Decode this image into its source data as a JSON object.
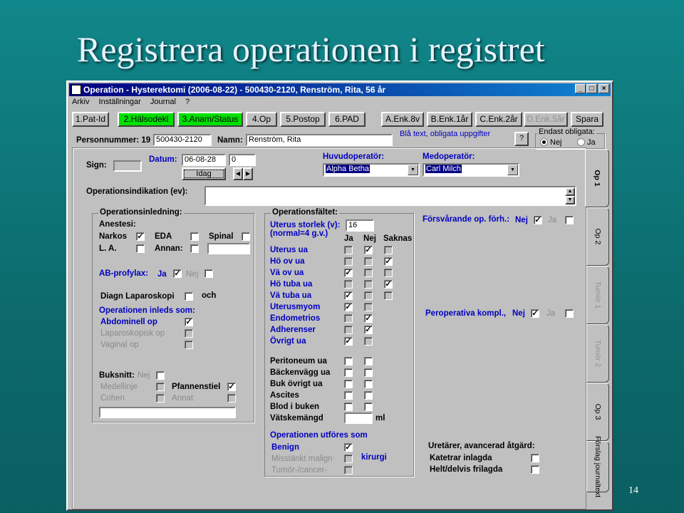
{
  "slide": {
    "title": "Registrera operationen i registret",
    "page_number": "14"
  },
  "window": {
    "title": "Operation - Hysterektomi (2006-08-22) - 500430-2120, Renström, Rita, 56 år",
    "menu": [
      "Arkiv",
      "Inställningar",
      "Journal",
      "?"
    ],
    "tabs": [
      {
        "label": "1.Pat-Id",
        "state": "normal"
      },
      {
        "label": "2.Hälsodekl",
        "state": "green"
      },
      {
        "label": "3.Anam/Status",
        "state": "green"
      },
      {
        "label": "4.Op",
        "state": "normal"
      },
      {
        "label": "5.Postop",
        "state": "normal"
      },
      {
        "label": "6.PAD",
        "state": "normal"
      },
      {
        "label": "A.Enk.8v",
        "state": "normal"
      },
      {
        "label": "B.Enk.1år",
        "state": "normal"
      },
      {
        "label": "C.Enk.2år",
        "state": "normal"
      },
      {
        "label": "D.Enk.5år",
        "state": "disabled"
      },
      {
        "label": "Spara",
        "state": "normal"
      }
    ],
    "patient": {
      "personnummer_label": "Personnummer: 19",
      "personnummer_value": "500430-2120",
      "namn_label": "Namn:",
      "namn_value": "Renström, Rita",
      "hint": "Blå text, obligata uppgifter",
      "help": "?",
      "endast_label": "Endast obligata:",
      "nej": "Nej",
      "ja": "Ja"
    },
    "header_fields": {
      "sign_label": "Sign:",
      "datum_label": "Datum:",
      "datum_value": "06-08-28",
      "datum_extra": "0",
      "idag": "Idag",
      "huvudoperator_label": "Huvudoperatör:",
      "huvudoperator_value": "Alpha Betha",
      "medoperator_label": "Medoperatör:",
      "medoperator_value": "Carl Milch",
      "indikation_label": "Operationsindikation (ev):"
    },
    "inledning": {
      "title": "Operationsinledning:",
      "anestesi": "Anestesi:",
      "narkos": "Narkos",
      "eda": "EDA",
      "spinal": "Spinal",
      "la": "L. A.",
      "annan": "Annan:",
      "ab_label": "AB-profylax:",
      "ja": "Ja",
      "nej": "Nej",
      "diagn": "Diagn Laparoskopi",
      "och": "och",
      "inleds": "Operationen inleds som:",
      "abdominell": "Abdominell op",
      "laparoskopisk": "Laparoskopisk op",
      "vaginal": "Vaginal op",
      "buksnitt": "Buksnitt:",
      "buk_nej": "Nej",
      "medellinje": "Medellinje",
      "pfannenstiel": "Pfannenstiel",
      "cohen": "Cohen",
      "annat": "Annat"
    },
    "faltet": {
      "title": "Operationsfältet:",
      "uterus_storlek": "Uterus storlek (v):",
      "uterus_storlek_value": "16",
      "normal": "(normal=4 g.v.)",
      "col_ja": "Ja",
      "col_nej": "Nej",
      "col_saknas": "Saknas",
      "rows_blue": [
        {
          "label": "Uterus ua",
          "marks": [
            0,
            1,
            0
          ]
        },
        {
          "label": "Hö ov ua",
          "marks": [
            0,
            0,
            1
          ]
        },
        {
          "label": "Vä ov ua",
          "marks": [
            1,
            0,
            0
          ]
        },
        {
          "label": "Hö tuba ua",
          "marks": [
            0,
            0,
            1
          ]
        },
        {
          "label": "Vä tuba ua",
          "marks": [
            1,
            0,
            0
          ]
        },
        {
          "label": "Uterusmyom",
          "marks": [
            1,
            0,
            -1
          ]
        },
        {
          "label": "Endometrios",
          "marks": [
            0,
            1,
            -1
          ]
        },
        {
          "label": "Adherenser",
          "marks": [
            0,
            1,
            -1
          ]
        },
        {
          "label": "Övrigt ua",
          "marks": [
            1,
            0,
            -1
          ]
        }
      ],
      "rows_black": [
        {
          "label": "Peritoneum ua"
        },
        {
          "label": "Bäckenvägg ua"
        },
        {
          "label": "Buk övrigt ua"
        },
        {
          "label": "Ascites"
        },
        {
          "label": "Blod i buken"
        }
      ],
      "vatske": "Vätskemängd",
      "ml": "ml",
      "utfores": "Operationen utföres som",
      "benign": "Benign",
      "misstankt": "Misstänkt malign",
      "tumor_cancer": "Tumör-/cancer-",
      "kirurgi": "kirurgi"
    },
    "right": {
      "forsvarande": "Försvårande op. förh.:",
      "nej": "Nej",
      "ja": "Ja",
      "peroperativa": "Peroperativa kompl.,",
      "ureter": "Uretärer, avancerad åtgärd:",
      "kateter": "Katetrar inlagda",
      "helt": "Helt/delvis frilagda"
    },
    "side_tabs": [
      {
        "label": "Op 1",
        "state": "active"
      },
      {
        "label": "Op 2",
        "state": "normal"
      },
      {
        "label": "Tumör 1",
        "state": "disabled"
      },
      {
        "label": "Tumör 2",
        "state": "disabled"
      },
      {
        "label": "Op 3",
        "state": "normal"
      },
      {
        "label": "Förslag journaltext",
        "state": "normal"
      }
    ]
  }
}
